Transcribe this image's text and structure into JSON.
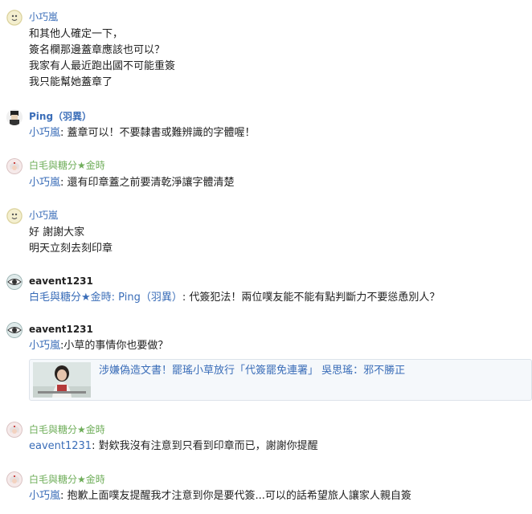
{
  "comments": [
    {
      "author": "小巧嵐",
      "lines": [
        "和其他人確定一下，",
        "簽名欄那邊蓋章應該也可以？",
        "我家有人最近跑出國不可能重簽",
        "我只能幫她蓋章了"
      ]
    },
    {
      "author": "Ping（羽異）",
      "reply_to": "小巧嵐",
      "text": ": 蓋章可以！不要隸書或難辨識的字體喔！"
    },
    {
      "author": "白毛與糖分★金時",
      "reply_to": "小巧嵐",
      "text": ": 還有印章蓋之前要清乾淨讓字體清楚"
    },
    {
      "author": "小巧嵐",
      "lines": [
        "好 謝謝大家",
        "明天立刻去刻印章"
      ]
    },
    {
      "author": "eavent1231",
      "reply_to": "白毛與糖分★金時: Ping（羽異）",
      "text": ": 代簽犯法！兩位噗友能不能有點判斷力不要慫恿別人？"
    },
    {
      "author": "eavent1231",
      "reply_to": "小巧嵐",
      "text": ":小草的事情你也要做？",
      "link_card": {
        "title": "涉嫌偽造文書！罷瑤小草放行「代簽罷免連署」 吳思瑤：邪不勝正"
      }
    },
    {
      "author": "白毛與糖分★金時",
      "reply_to": "eavent1231",
      "text": ": 對欸我沒有注意到只看到印章而已，謝謝你提醒"
    },
    {
      "author": "白毛與糖分★金時",
      "reply_to": "小巧嵐",
      "text": ": 抱歉上面噗友提醒我才注意到你是要代簽...可以的話希望旅人讓家人親自簽"
    }
  ],
  "colors": {
    "mention": "#3a6db8",
    "author_green": "#6fae5a",
    "author_blue": "#3a6db8"
  }
}
